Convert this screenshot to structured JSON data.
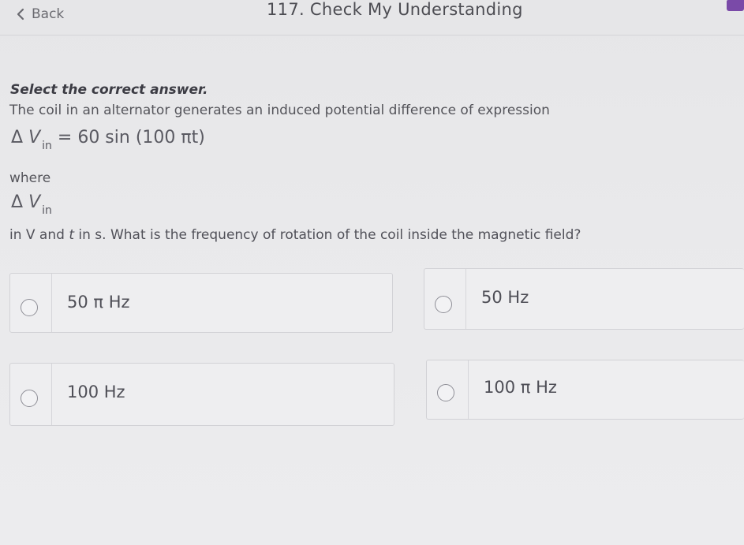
{
  "header": {
    "back_label": "Back",
    "title": "117. Check My Understanding"
  },
  "question": {
    "instruction": "Select the correct answer.",
    "prompt": "The coil in an alternator generates an induced potential difference of expression",
    "equation": {
      "delta": "Δ",
      "v": "V",
      "sub": "in",
      "rhs": " = 60 sin (100 πt)"
    },
    "where": "where",
    "symbol": {
      "delta": "Δ",
      "v": "V",
      "sub": "in"
    },
    "text": {
      "part1": "in V and ",
      "t": "t",
      "part2": " in s. What is the frequency of rotation of the coil inside the magnetic field?"
    }
  },
  "options": [
    {
      "label": "50 π Hz",
      "selected": false
    },
    {
      "label": "50 Hz",
      "selected": false
    },
    {
      "label": "100 Hz",
      "selected": false
    },
    {
      "label": "100 π Hz",
      "selected": false
    }
  ],
  "icons": {
    "back": "chevron-left-icon",
    "radio": "radio-unchecked-icon"
  },
  "colors": {
    "badge": "#7a4aa8",
    "background": "#e9e9eb"
  }
}
